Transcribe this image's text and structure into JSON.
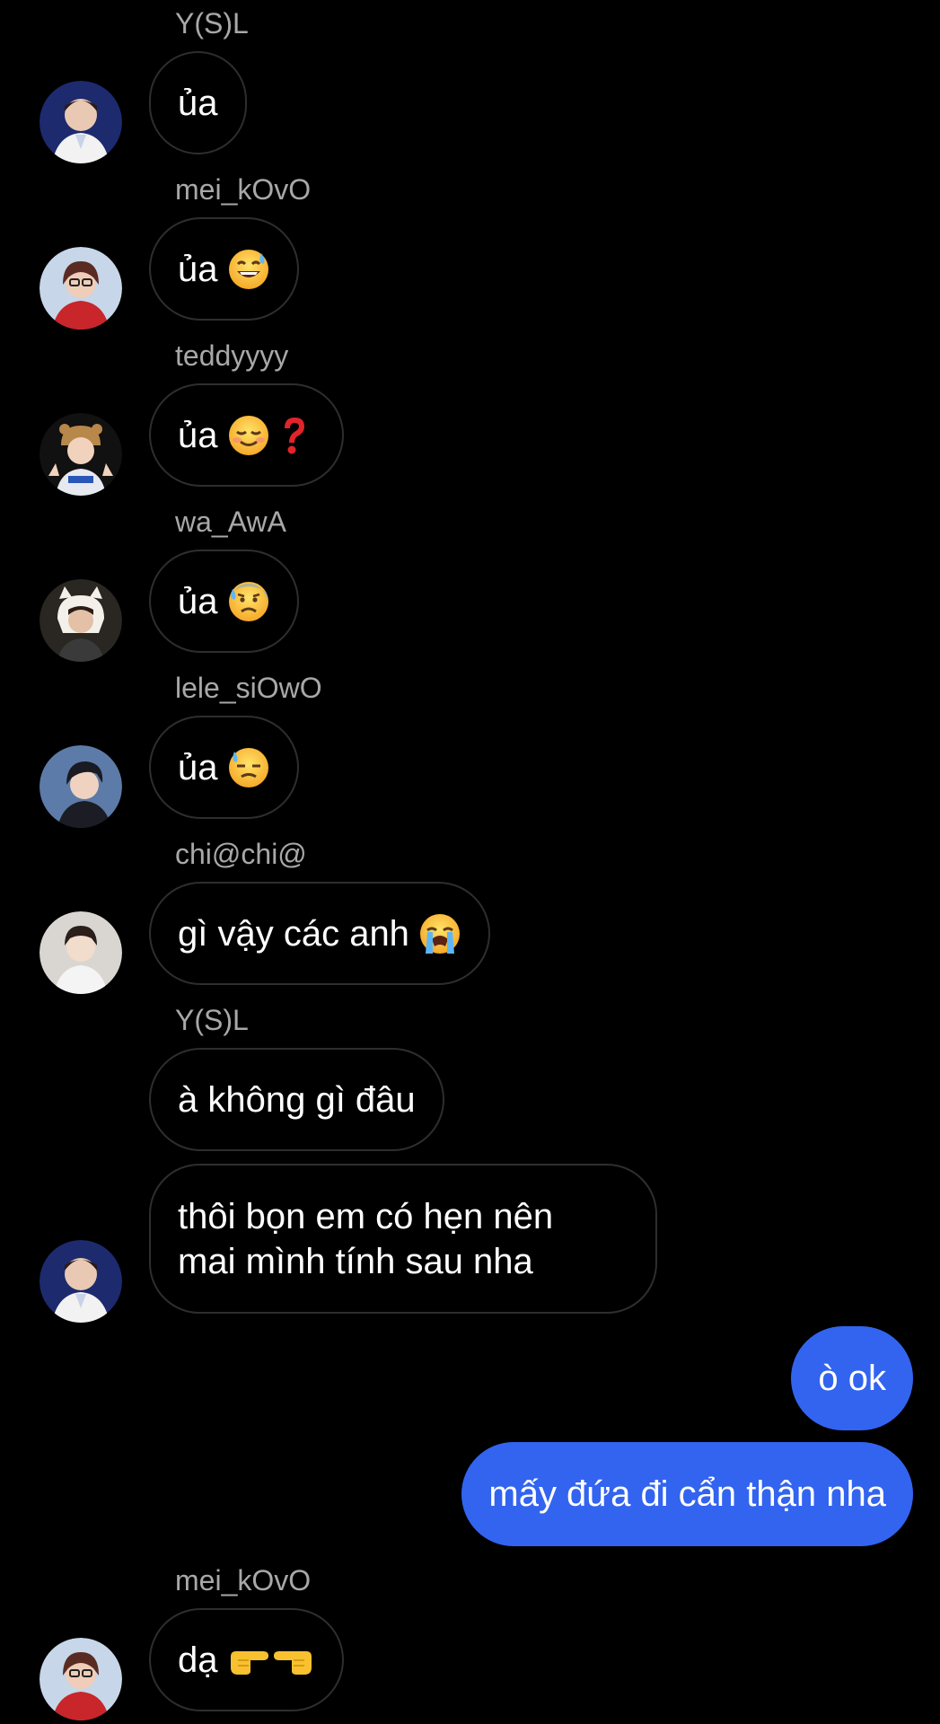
{
  "colors": {
    "background": "#000000",
    "incoming_bubble_border": "#2e2e2e",
    "outgoing_bubble": "#3264f0",
    "sender_name": "#a8a8a8",
    "text": "#ffffff"
  },
  "messages": [
    {
      "sender": "Y(S)L",
      "text": "ủa",
      "emoji": []
    },
    {
      "sender": "mei_kOvO",
      "text": "ủa",
      "emoji": [
        "sweat-smile-emoji"
      ]
    },
    {
      "sender": "teddyyyy",
      "text": "ủa",
      "emoji": [
        "relieved-smile-emoji",
        "red-question-mark-emoji"
      ]
    },
    {
      "sender": "wa_AwA",
      "text": "ủa",
      "emoji": [
        "anxious-sweat-emoji"
      ]
    },
    {
      "sender": "lele_siOwO",
      "text": "ủa",
      "emoji": [
        "downcast-sweat-emoji"
      ]
    },
    {
      "sender": "chi@chi@",
      "text": "gì vậy các anh",
      "emoji": [
        "loudly-crying-emoji"
      ]
    },
    {
      "sender": "Y(S)L",
      "text": "à không gì đâu",
      "emoji": []
    },
    {
      "sender": "",
      "text_lines": [
        "thôi bọn em có hẹn nên",
        "mai mình tính sau nha"
      ],
      "emoji": []
    },
    {
      "sender": "me",
      "text": "ò ok",
      "emoji": []
    },
    {
      "sender": "me",
      "text": "mấy đứa đi cẩn thận nha",
      "emoji": []
    },
    {
      "sender": "mei_kOvO",
      "text": "dạ",
      "emoji": [
        "pointing-right-emoji",
        "pointing-left-emoji"
      ]
    }
  ]
}
